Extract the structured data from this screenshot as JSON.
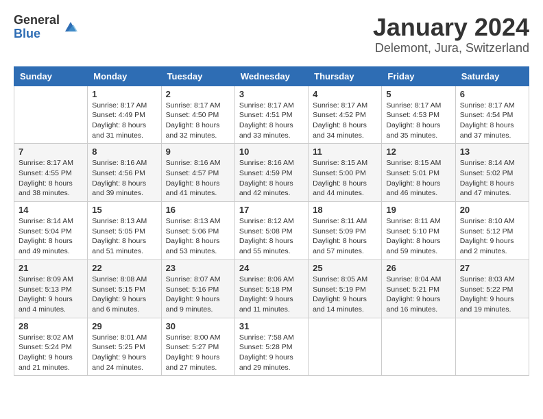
{
  "logo": {
    "general": "General",
    "blue": "Blue"
  },
  "title": "January 2024",
  "subtitle": "Delemont, Jura, Switzerland",
  "weekdays": [
    "Sunday",
    "Monday",
    "Tuesday",
    "Wednesday",
    "Thursday",
    "Friday",
    "Saturday"
  ],
  "weeks": [
    [
      {
        "day": "",
        "info": ""
      },
      {
        "day": "1",
        "info": "Sunrise: 8:17 AM\nSunset: 4:49 PM\nDaylight: 8 hours\nand 31 minutes."
      },
      {
        "day": "2",
        "info": "Sunrise: 8:17 AM\nSunset: 4:50 PM\nDaylight: 8 hours\nand 32 minutes."
      },
      {
        "day": "3",
        "info": "Sunrise: 8:17 AM\nSunset: 4:51 PM\nDaylight: 8 hours\nand 33 minutes."
      },
      {
        "day": "4",
        "info": "Sunrise: 8:17 AM\nSunset: 4:52 PM\nDaylight: 8 hours\nand 34 minutes."
      },
      {
        "day": "5",
        "info": "Sunrise: 8:17 AM\nSunset: 4:53 PM\nDaylight: 8 hours\nand 35 minutes."
      },
      {
        "day": "6",
        "info": "Sunrise: 8:17 AM\nSunset: 4:54 PM\nDaylight: 8 hours\nand 37 minutes."
      }
    ],
    [
      {
        "day": "7",
        "info": "Sunrise: 8:17 AM\nSunset: 4:55 PM\nDaylight: 8 hours\nand 38 minutes."
      },
      {
        "day": "8",
        "info": "Sunrise: 8:16 AM\nSunset: 4:56 PM\nDaylight: 8 hours\nand 39 minutes."
      },
      {
        "day": "9",
        "info": "Sunrise: 8:16 AM\nSunset: 4:57 PM\nDaylight: 8 hours\nand 41 minutes."
      },
      {
        "day": "10",
        "info": "Sunrise: 8:16 AM\nSunset: 4:59 PM\nDaylight: 8 hours\nand 42 minutes."
      },
      {
        "day": "11",
        "info": "Sunrise: 8:15 AM\nSunset: 5:00 PM\nDaylight: 8 hours\nand 44 minutes."
      },
      {
        "day": "12",
        "info": "Sunrise: 8:15 AM\nSunset: 5:01 PM\nDaylight: 8 hours\nand 46 minutes."
      },
      {
        "day": "13",
        "info": "Sunrise: 8:14 AM\nSunset: 5:02 PM\nDaylight: 8 hours\nand 47 minutes."
      }
    ],
    [
      {
        "day": "14",
        "info": "Sunrise: 8:14 AM\nSunset: 5:04 PM\nDaylight: 8 hours\nand 49 minutes."
      },
      {
        "day": "15",
        "info": "Sunrise: 8:13 AM\nSunset: 5:05 PM\nDaylight: 8 hours\nand 51 minutes."
      },
      {
        "day": "16",
        "info": "Sunrise: 8:13 AM\nSunset: 5:06 PM\nDaylight: 8 hours\nand 53 minutes."
      },
      {
        "day": "17",
        "info": "Sunrise: 8:12 AM\nSunset: 5:08 PM\nDaylight: 8 hours\nand 55 minutes."
      },
      {
        "day": "18",
        "info": "Sunrise: 8:11 AM\nSunset: 5:09 PM\nDaylight: 8 hours\nand 57 minutes."
      },
      {
        "day": "19",
        "info": "Sunrise: 8:11 AM\nSunset: 5:10 PM\nDaylight: 8 hours\nand 59 minutes."
      },
      {
        "day": "20",
        "info": "Sunrise: 8:10 AM\nSunset: 5:12 PM\nDaylight: 9 hours\nand 2 minutes."
      }
    ],
    [
      {
        "day": "21",
        "info": "Sunrise: 8:09 AM\nSunset: 5:13 PM\nDaylight: 9 hours\nand 4 minutes."
      },
      {
        "day": "22",
        "info": "Sunrise: 8:08 AM\nSunset: 5:15 PM\nDaylight: 9 hours\nand 6 minutes."
      },
      {
        "day": "23",
        "info": "Sunrise: 8:07 AM\nSunset: 5:16 PM\nDaylight: 9 hours\nand 9 minutes."
      },
      {
        "day": "24",
        "info": "Sunrise: 8:06 AM\nSunset: 5:18 PM\nDaylight: 9 hours\nand 11 minutes."
      },
      {
        "day": "25",
        "info": "Sunrise: 8:05 AM\nSunset: 5:19 PM\nDaylight: 9 hours\nand 14 minutes."
      },
      {
        "day": "26",
        "info": "Sunrise: 8:04 AM\nSunset: 5:21 PM\nDaylight: 9 hours\nand 16 minutes."
      },
      {
        "day": "27",
        "info": "Sunrise: 8:03 AM\nSunset: 5:22 PM\nDaylight: 9 hours\nand 19 minutes."
      }
    ],
    [
      {
        "day": "28",
        "info": "Sunrise: 8:02 AM\nSunset: 5:24 PM\nDaylight: 9 hours\nand 21 minutes."
      },
      {
        "day": "29",
        "info": "Sunrise: 8:01 AM\nSunset: 5:25 PM\nDaylight: 9 hours\nand 24 minutes."
      },
      {
        "day": "30",
        "info": "Sunrise: 8:00 AM\nSunset: 5:27 PM\nDaylight: 9 hours\nand 27 minutes."
      },
      {
        "day": "31",
        "info": "Sunrise: 7:58 AM\nSunset: 5:28 PM\nDaylight: 9 hours\nand 29 minutes."
      },
      {
        "day": "",
        "info": ""
      },
      {
        "day": "",
        "info": ""
      },
      {
        "day": "",
        "info": ""
      }
    ]
  ]
}
